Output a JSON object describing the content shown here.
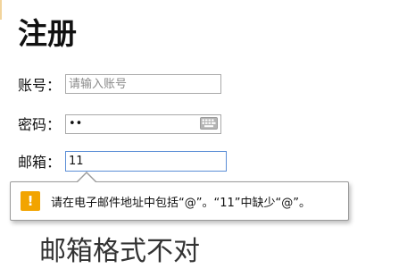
{
  "form": {
    "title": "注册",
    "account": {
      "label": "账号：",
      "placeholder": "请输入账号",
      "value": ""
    },
    "password": {
      "label": "密码：",
      "value": "••",
      "icon": "keyboard-icon"
    },
    "email": {
      "label": "邮箱：",
      "value": "11"
    }
  },
  "validation_tooltip": {
    "icon": "warning-icon",
    "icon_glyph": "!",
    "icon_color": "#f2a400",
    "message": "请在电子邮件地址中包括“@”。“11”中缺少“@”。"
  },
  "error_message": "邮箱格式不对"
}
